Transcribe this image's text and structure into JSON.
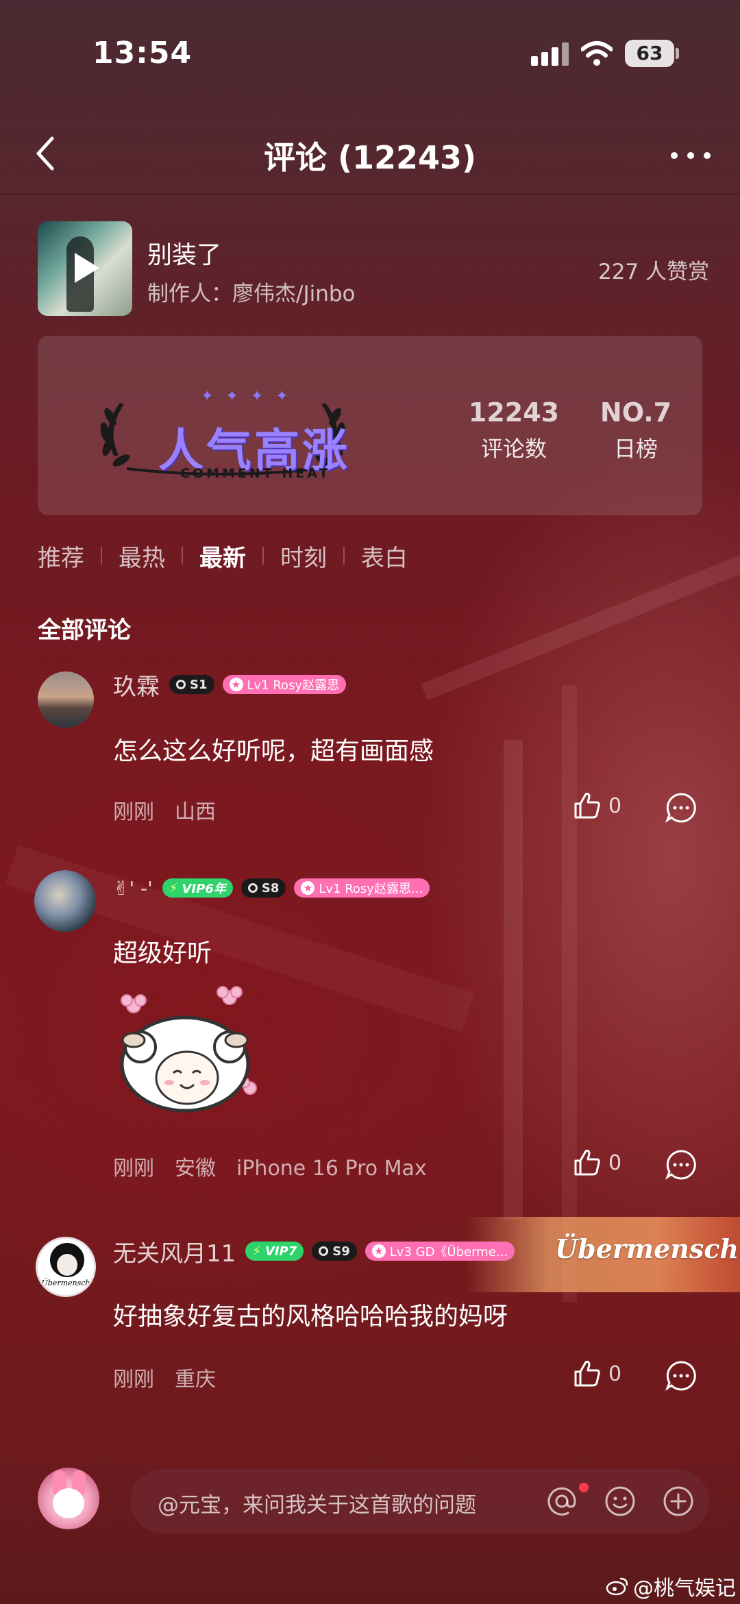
{
  "status_bar": {
    "time": "13:54",
    "battery": "63"
  },
  "nav": {
    "title": "评论 (12243)"
  },
  "song": {
    "name": "别装了",
    "producer": "制作人：廖伟杰/Jinbo",
    "likes": "227 人赞赏"
  },
  "heat": {
    "logo_title": "人气高涨",
    "logo_sub": "COMMENT HEAT",
    "logo_stars": "✦✦✦✦",
    "comments_value": "12243",
    "comments_label": "评论数",
    "rank_value": "NO.7",
    "rank_label": "日榜"
  },
  "tabs": [
    "推荐",
    "最热",
    "最新",
    "时刻",
    "表白"
  ],
  "active_tab": "最新",
  "section_title": "全部评论",
  "comments": [
    {
      "user": "玖霖",
      "level": "S1",
      "fan_badge": "Lv1 Rosy赵露思",
      "text": "怎么这么好听呢，超有画面感",
      "time": "刚刚",
      "location": "山西",
      "likes": "0"
    },
    {
      "user": "✌' -'",
      "vip": "VIP6年",
      "level": "S8",
      "fan_badge": "Lv1 Rosy赵露思...",
      "text": "超级好听",
      "time": "刚刚",
      "location": "安徽",
      "device": "iPhone 16 Pro Max",
      "likes": "0"
    },
    {
      "user": "无关风月11",
      "vip": "VIP7",
      "level": "S9",
      "fan_badge": "Lv3 GD《Überme...",
      "banner": "Übermensch",
      "avatar_caption": "Übermensch",
      "text": "好抽象好复古的风格哈哈哈我的妈呀",
      "time": "刚刚",
      "location": "重庆",
      "likes": "0"
    }
  ],
  "input": {
    "placeholder": "@元宝，来问我关于这首歌的问题"
  },
  "watermark": "@桃气娱记",
  "colors": {
    "vip_green": "#2fd36b",
    "fan_pink": "#ff6fb3",
    "heat_purple": "#9a82ff",
    "notify_red": "#ff3b4b"
  },
  "icons": [
    "back-icon",
    "more-icon",
    "play-icon",
    "like-icon",
    "reply-icon",
    "at-icon",
    "emoji-icon",
    "plus-icon",
    "wifi-icon",
    "signal-icon",
    "weibo-icon"
  ]
}
